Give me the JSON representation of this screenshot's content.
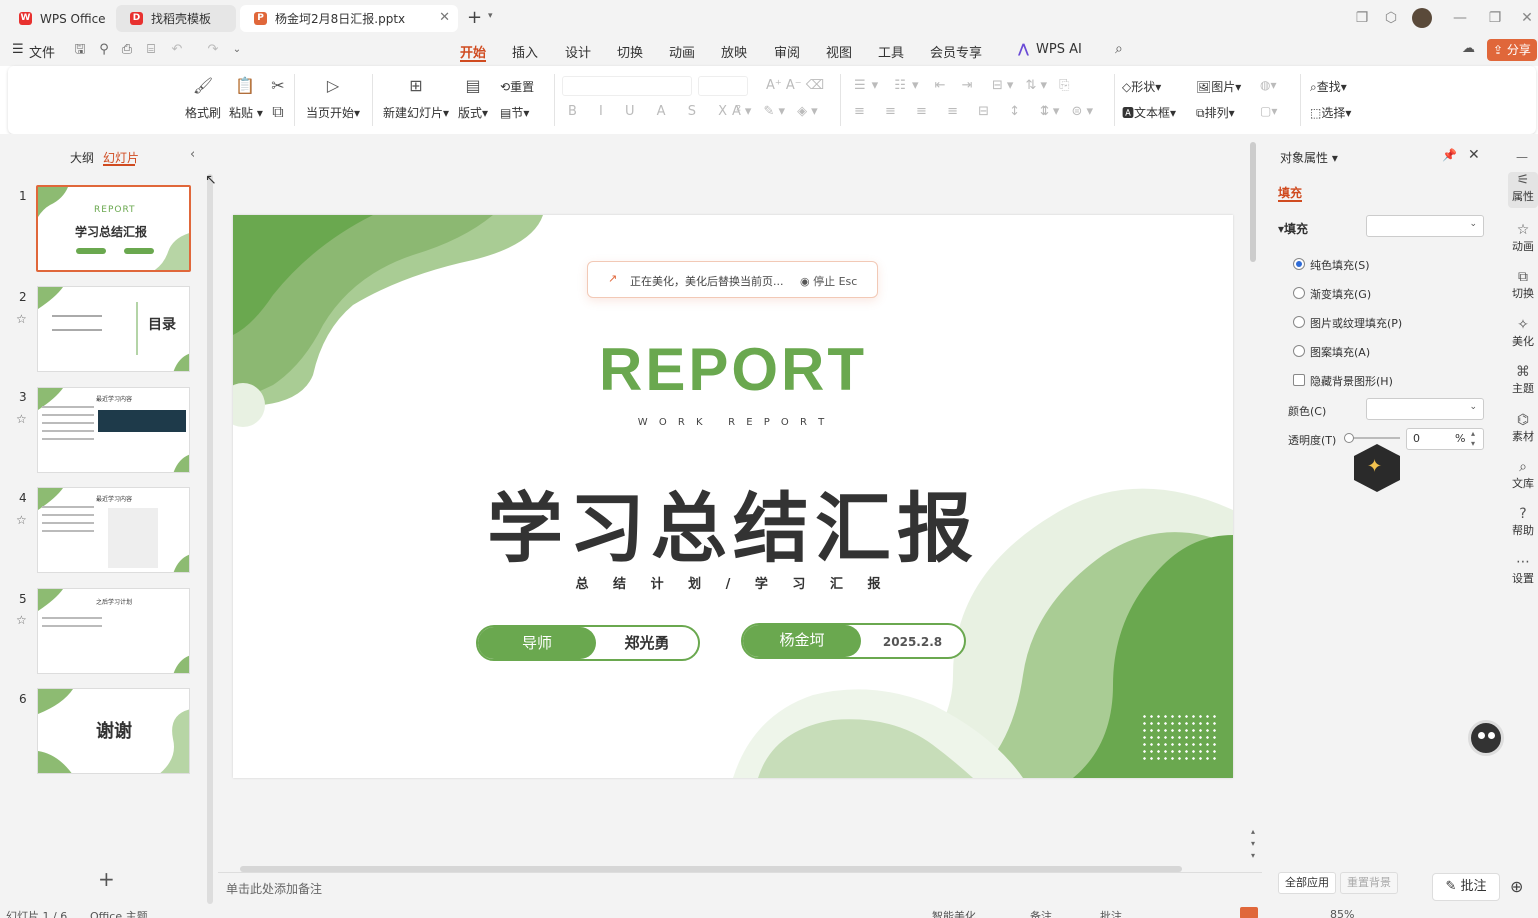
{
  "tabs": [
    {
      "label": "WPS Office",
      "icon": "wps-logo"
    },
    {
      "label": "找稻壳模板",
      "icon": "docer-icon"
    },
    {
      "label": "杨金坷2月8日汇报.pptx",
      "icon": "ppt-icon"
    }
  ],
  "menu": {
    "file": "文件",
    "items": [
      "开始",
      "插入",
      "设计",
      "切换",
      "动画",
      "放映",
      "审阅",
      "视图",
      "工具",
      "会员专享"
    ],
    "active": "开始",
    "ai": "WPS AI",
    "share": "分享"
  },
  "ribbon": {
    "format_painter": "格式刷",
    "paste": "粘贴",
    "start_from_current": "当页开始",
    "new_slide": "新建幻灯片",
    "layout": "版式",
    "reset": "重置",
    "section": "节",
    "shape": "形状",
    "picture": "图片",
    "find": "查找",
    "textbox": "文本框",
    "arrange": "排列",
    "select": "选择"
  },
  "left_pane": {
    "tab_outline": "大纲",
    "tab_slides": "幻灯片",
    "slide_numbers": [
      "1",
      "2",
      "3",
      "4",
      "5",
      "6"
    ],
    "thumb1_title": "学习总结汇报",
    "thumb1_sub": "REPORT",
    "thumb2_title": "目录",
    "thumb3_header": "最近学习内容",
    "thumb4_header": "最近学习内容",
    "thumb5_header": "之后学习计划",
    "thumb6_title": "谢谢",
    "add": "+"
  },
  "slide": {
    "notice_text": "正在美化，美化后替换当前页...",
    "stop_label": "停止 Esc",
    "report": "REPORT",
    "work_report": "W O R K   R E P O R T",
    "main_title": "学习总结汇报",
    "subtitle": "总 结 计 划 / 学 习 汇 报",
    "mentor_label": "导师",
    "mentor_name": "郑光勇",
    "author_name": "杨金坷",
    "date": "2025.2.8",
    "colors": {
      "green": "#6aa84f",
      "light_green": "#a9cc94",
      "text": "#333333"
    }
  },
  "notes_placeholder": "单击此处添加备注",
  "right_pane": {
    "title": "对象属性",
    "tab": "填充",
    "section": "填充",
    "options": [
      "纯色填充(S)",
      "渐变填充(G)",
      "图片或纹理填充(P)",
      "图案填充(A)"
    ],
    "selected_option": "纯色填充(S)",
    "hide_bg": "隐藏背景图形(H)",
    "color_label": "颜色(C)",
    "transparency_label": "透明度(T)",
    "transparency_value": "0",
    "transparency_unit": "%",
    "apply_all": "全部应用",
    "reset_bg": "重置背景"
  },
  "sidebar_items": [
    "属性",
    "动画",
    "切换",
    "美化",
    "主题",
    "素材",
    "文库",
    "帮助",
    "设置"
  ],
  "annotate_label": "批注",
  "status": {
    "slide_info": "幻灯片 1 / 6",
    "theme": "Office 主题",
    "smart_beautify": "智能美化",
    "notes": "备注",
    "comment": "批注",
    "zoom": "85%"
  }
}
